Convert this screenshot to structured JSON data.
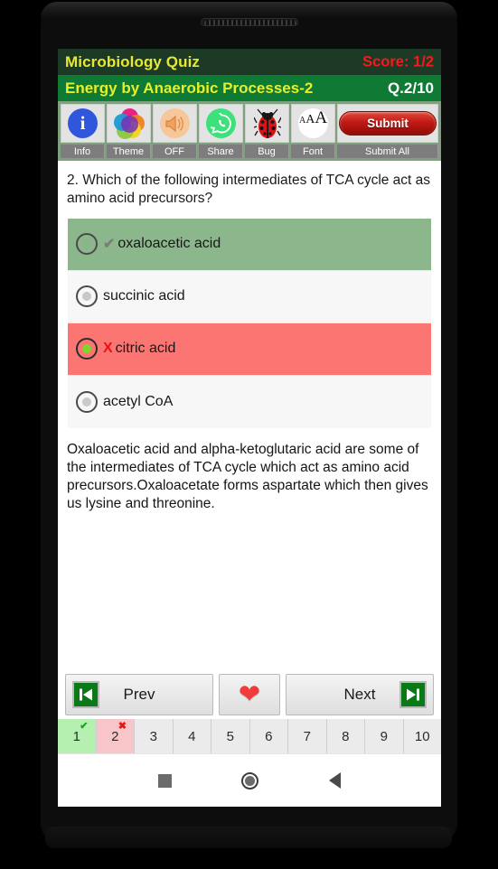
{
  "app": {
    "title": "Microbiology Quiz",
    "score_label": "Score: 1/2",
    "topic": "Energy by Anaerobic Processes-2",
    "question_counter": "Q.2/10"
  },
  "toolbar": {
    "items": [
      {
        "icon": "info-icon",
        "label": "Info"
      },
      {
        "icon": "theme-icon",
        "label": "Theme"
      },
      {
        "icon": "sound-off-icon",
        "label": "OFF"
      },
      {
        "icon": "share-icon",
        "label": "Share"
      },
      {
        "icon": "bug-icon",
        "label": "Bug"
      },
      {
        "icon": "font-size-icon",
        "label": "Font"
      }
    ],
    "submit_button": "Submit",
    "submit_all_label": "Submit All"
  },
  "question": {
    "text": "2. Which of the following intermediates of TCA cycle act as amino acid precursors?",
    "options": [
      {
        "label": "oxaloacetic acid",
        "state": "correct",
        "mark": "✔",
        "selected": false
      },
      {
        "label": "succinic acid",
        "state": "neutral",
        "mark": "",
        "selected": false
      },
      {
        "label": "citric acid",
        "state": "wrong",
        "mark": "X",
        "selected": true
      },
      {
        "label": "acetyl CoA",
        "state": "neutral",
        "mark": "",
        "selected": false
      }
    ],
    "explanation": "Oxaloacetic acid and alpha-ketoglutaric acid are some of the intermediates of TCA cycle which act as amino acid precursors.Oxaloacetate forms aspartate which then gives us lysine and threonine."
  },
  "nav": {
    "prev_label": "Prev",
    "next_label": "Next",
    "favorite_icon": "heart-icon",
    "first_icon": "skip-to-start-icon",
    "last_icon": "skip-to-end-icon"
  },
  "pager": {
    "pages": [
      {
        "number": "1",
        "state": "ok",
        "badge": "✔"
      },
      {
        "number": "2",
        "state": "bad",
        "badge": "✖"
      },
      {
        "number": "3",
        "state": "neutral",
        "badge": ""
      },
      {
        "number": "4",
        "state": "neutral",
        "badge": ""
      },
      {
        "number": "5",
        "state": "neutral",
        "badge": ""
      },
      {
        "number": "6",
        "state": "neutral",
        "badge": ""
      },
      {
        "number": "7",
        "state": "neutral",
        "badge": ""
      },
      {
        "number": "8",
        "state": "neutral",
        "badge": ""
      },
      {
        "number": "9",
        "state": "neutral",
        "badge": ""
      },
      {
        "number": "10",
        "state": "neutral",
        "badge": ""
      }
    ]
  },
  "system_nav": {
    "recent_icon": "recent-apps-icon",
    "home_icon": "home-icon",
    "back_icon": "back-icon"
  },
  "colors": {
    "header_bg": "#1d3a26",
    "subheader_bg": "#0f7a34",
    "title_text": "#e8e830",
    "score_text": "#f31b1b",
    "correct_option": "#8cb68c",
    "wrong_option": "#fb7572",
    "submit_red": "#c21a15"
  }
}
